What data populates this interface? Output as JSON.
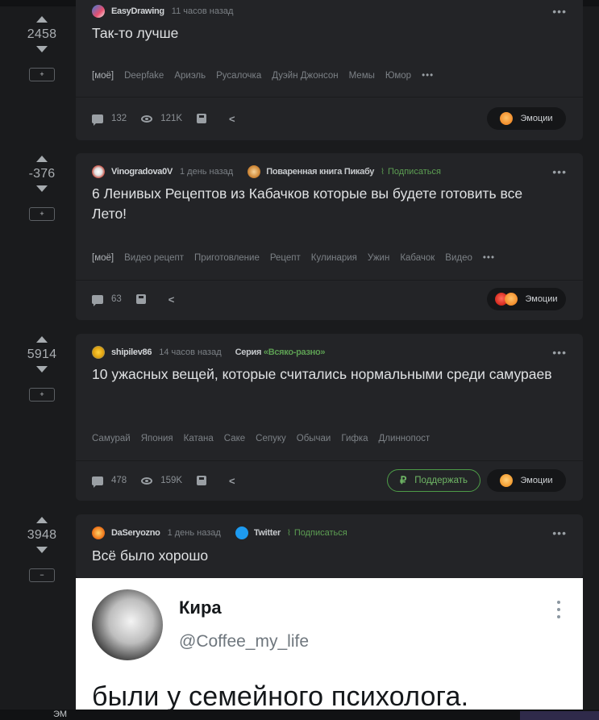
{
  "posts": [
    {
      "rating": "2458",
      "save_label": "+",
      "author": "EasyDrawing",
      "time": "11 часов назад",
      "title": "Так-то лучше",
      "tags": [
        "[моё]",
        "Deepfake",
        "Ариэль",
        "Русалочка",
        "Дуэйн Джонсон",
        "Мемы",
        "Юмор"
      ],
      "comments": "132",
      "views": "121K",
      "emotions_label": "Эмоции"
    },
    {
      "rating": "-376",
      "save_label": "+",
      "author": "Vinogradova0V",
      "time": "1 день назад",
      "community": "Поваренная книга Пикабу",
      "subscribe": "Подписаться",
      "title": "6 Ленивых Рецептов из Кабачков которые вы будете готовить все Лето!",
      "tags": [
        "[моё]",
        "Видео рецепт",
        "Приготовление",
        "Рецепт",
        "Кулинария",
        "Ужин",
        "Кабачок",
        "Видео"
      ],
      "comments": "63",
      "emotions_label": "Эмоции"
    },
    {
      "rating": "5914",
      "save_label": "+",
      "author": "shipilev86",
      "time": "14 часов назад",
      "series_prefix": "Серия",
      "series_name": "«Всяко-разно»",
      "title": "10 ужасных вещей, которые считались нормальными среди самураев",
      "tags": [
        "Самурай",
        "Япония",
        "Катана",
        "Саке",
        "Сепуку",
        "Обычаи",
        "Гифка",
        "Длиннопост"
      ],
      "comments": "478",
      "views": "159K",
      "support_label": "Поддержать",
      "emotions_label": "Эмоции"
    },
    {
      "rating": "3948",
      "save_label": "−",
      "author": "DaSeryozno",
      "time": "1 день назад",
      "community": "Twitter",
      "subscribe": "Подписаться",
      "title": "Всё было хорошо",
      "embed": {
        "name": "Кира",
        "handle": "@Coffee_my_life",
        "text": "были у семейного психолога."
      }
    }
  ],
  "icons": {
    "upvote": "triangle-up",
    "downvote": "triangle-down",
    "comments": "comment-icon",
    "views": "eye-icon",
    "save": "save-icon",
    "share": "share-icon",
    "more": "more-dots-icon"
  },
  "colors": {
    "background": "#1a1b1d",
    "card": "#232427",
    "accent_green": "#5d9f53",
    "text_muted": "#7c8186"
  },
  "footer_fragment": "ЭМ"
}
